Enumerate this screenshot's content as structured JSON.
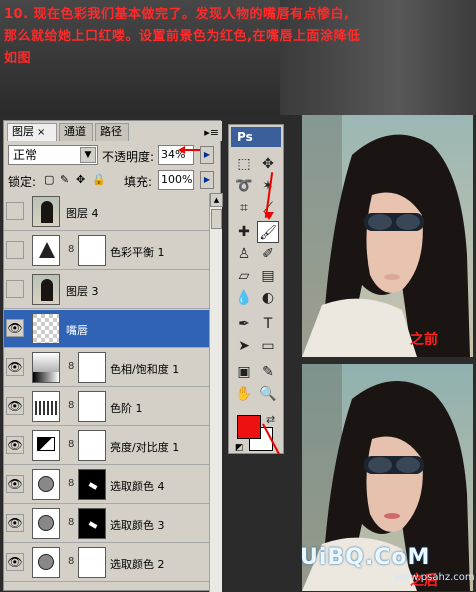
{
  "instructions": {
    "line1": "10. 现在色彩我们基本做完了。发现人物的嘴唇有点惨白,",
    "line2": "那么就给她上口红喽。设置前景色为红色,在嘴唇上面涂降低",
    "line3": "如图"
  },
  "layers_panel": {
    "tabs": [
      "图层",
      "通道",
      "路径"
    ],
    "tab_close": "×",
    "menu_icon": "▸≡",
    "blend_mode": "正常",
    "opacity_label": "不透明度:",
    "opacity_value": "34%",
    "lock_label": "锁定:",
    "fill_label": "填充:",
    "fill_value": "100%",
    "layers": [
      {
        "name": "图层 4",
        "visible": false,
        "type": "photo",
        "mask": false
      },
      {
        "name": "色彩平衡 1",
        "visible": false,
        "type": "balance",
        "mask": true
      },
      {
        "name": "图层 3",
        "visible": false,
        "type": "photo",
        "mask": false
      },
      {
        "name": "嘴唇",
        "visible": true,
        "type": "transparent",
        "mask": false,
        "selected": true
      },
      {
        "name": "色相/饱和度 1",
        "visible": true,
        "type": "hue",
        "mask": true
      },
      {
        "name": "色阶 1",
        "visible": true,
        "type": "levels",
        "mask": true
      },
      {
        "name": "亮度/对比度 1",
        "visible": true,
        "type": "brightness",
        "mask": true
      },
      {
        "name": "选取颜色 4",
        "visible": true,
        "type": "selective",
        "mask": true,
        "mask_dark": true
      },
      {
        "name": "选取颜色 3",
        "visible": true,
        "type": "selective",
        "mask": true,
        "mask_dark": true
      },
      {
        "name": "选取颜色 2",
        "visible": true,
        "type": "selective",
        "mask": true,
        "mask_dark": false
      }
    ]
  },
  "toolbox": {
    "logo": "Ps",
    "foreground_color": "#ee1111",
    "background_color": "#ffffff"
  },
  "photos": {
    "before_label": "之前",
    "after_label": "之后"
  },
  "watermark": {
    "main": "UiBQ.CoM",
    "sub": "www.psahz.com"
  },
  "colors": {
    "accent_red": "#ff2a2a",
    "selected_layer": "#3163b5"
  }
}
